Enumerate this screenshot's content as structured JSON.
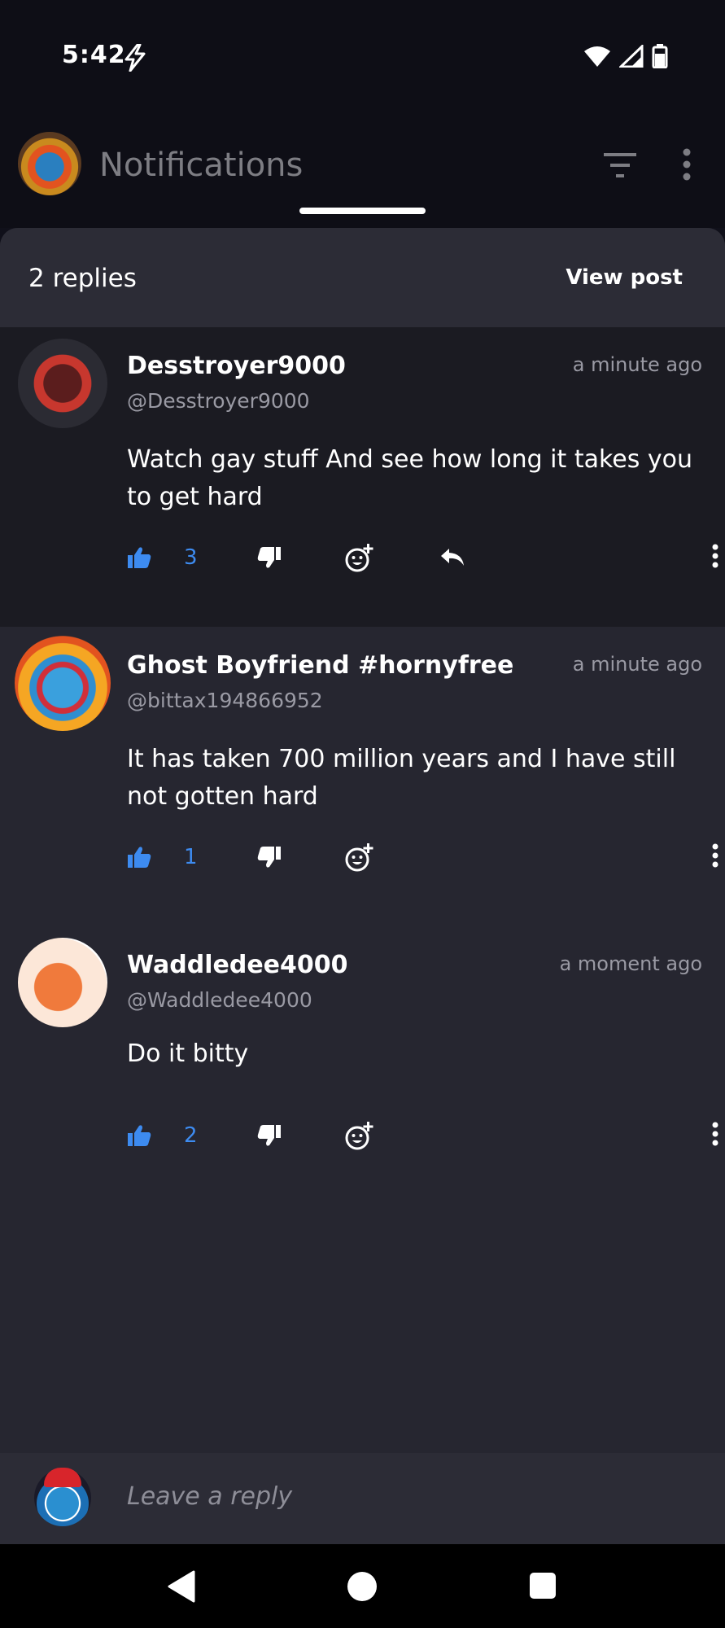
{
  "status_bar": {
    "time": "5:42"
  },
  "header": {
    "title": "Notifications"
  },
  "sheet": {
    "replies_count": "2 replies",
    "view_post_label": "View post"
  },
  "comments": [
    {
      "username": "Desstroyer9000",
      "handle": "@Desstroyer9000",
      "timestamp": "a minute ago",
      "body": "Watch gay stuff And see how long it takes you to get hard",
      "likes": "3",
      "has_reply": true
    },
    {
      "username": "Ghost Boyfriend #hornyfree",
      "handle": "@bittax194866952",
      "timestamp": "a minute ago",
      "body": "It has taken 700 million years and I have still not gotten hard",
      "likes": "1",
      "has_reply": false
    },
    {
      "username": "Waddledee4000",
      "handle": "@Waddledee4000",
      "timestamp": "a moment ago",
      "body": "Do it bitty",
      "likes": "2",
      "has_reply": false
    }
  ],
  "reply_bar": {
    "placeholder": "Leave a reply"
  },
  "colors": {
    "accent": "#3d8bf0",
    "background": "#262630",
    "header": "#0e0e16"
  }
}
